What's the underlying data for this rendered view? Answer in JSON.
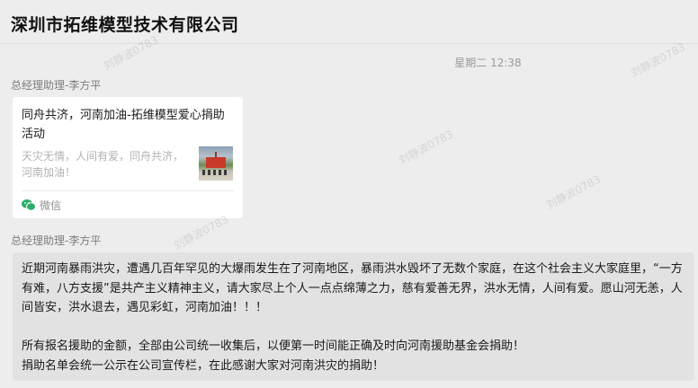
{
  "header": {
    "title": "深圳市拓维模型技术有限公司"
  },
  "timestamp": "星期二 12:38",
  "messages": [
    {
      "sender": "总经理助理-李方平",
      "card": {
        "title": "同舟共济，河南加油-拓维模型爱心捐助活动",
        "description": "天灾无情，人间有爱，同舟共济，河南加油！",
        "source": "微信",
        "source_icon": "wechat-icon",
        "thumbnail_icon": "event-photo-thumbnail"
      }
    },
    {
      "sender": "总经理助理-李方平",
      "paragraphs": [
        "近期河南暴雨洪灾，遭遇几百年罕见的大爆雨发生在了河南地区，暴雨洪水毁坏了无数个家庭，在这个社会主义大家庭里，“一方有难，八方支援”是共产主义精神主义，请大家尽上个人一点点绵薄之力，慈有爱善无界，洪水无情，人间有爱。愿山河无恙，人间皆安，洪水退去，遇见彩虹，河南加油！！！",
        "所有报名援助的金额，全部由公司统一收集后，以便第一时间能正确及时向河南援助基金会捐助！",
        "捐助名单会统一公示在公司宣传栏，在此感谢大家对河南洪灾的捐助！"
      ]
    }
  ],
  "watermark": "刘静波0783",
  "colors": {
    "background": "#ededed",
    "bubble": "#e2e2e2",
    "card": "#ffffff",
    "wechat_green": "#2aae67"
  }
}
